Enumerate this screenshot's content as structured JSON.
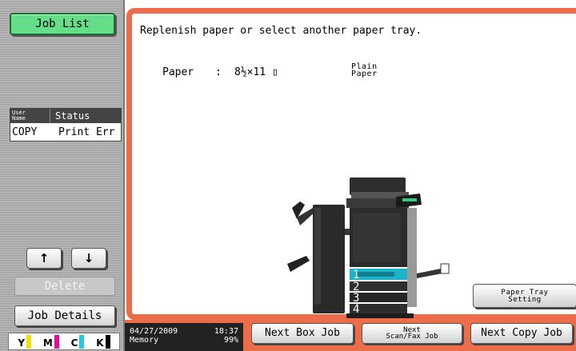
{
  "sidebar": {
    "job_list_label": "Job List",
    "table": {
      "header_user": [
        "User",
        "Name"
      ],
      "header_status": "Status",
      "rows": [
        {
          "user": "COPY",
          "status": "Print Err"
        }
      ]
    },
    "up_arrow": "↑",
    "down_arrow": "↓",
    "delete_label": "Delete",
    "job_details_label": "Job Details",
    "toner": [
      {
        "letter": "Y",
        "color": "#f2e200"
      },
      {
        "letter": "M",
        "color": "#e0109a"
      },
      {
        "letter": "C",
        "color": "#1ec8e8"
      },
      {
        "letter": "K",
        "color": "#000000"
      }
    ]
  },
  "main": {
    "message": "Replenish paper or select another paper tray.",
    "paper_label": "Paper",
    "paper_colon": ":",
    "paper_size": "8½×11 ▯",
    "paper_type_lines": [
      "Plain",
      "Paper"
    ],
    "tray_numbers": [
      "1",
      "2",
      "3",
      "4"
    ],
    "selected_tray": "1",
    "paper_tray_setting_lines": [
      "Paper Tray",
      "Setting"
    ]
  },
  "footer": {
    "date": "04/27/2009",
    "time": "18:37",
    "memory_label": "Memory",
    "memory_value": "99%",
    "next_box_job": "Next Box Job",
    "next_scan_fax_lines": [
      "Next",
      "Scan/Fax Job"
    ],
    "next_copy_job": "Next Copy Job"
  },
  "colors": {
    "frame_accent": "#ec6d48",
    "job_list_button": "#66dd88",
    "selected_tray": "#1ab5c8"
  }
}
